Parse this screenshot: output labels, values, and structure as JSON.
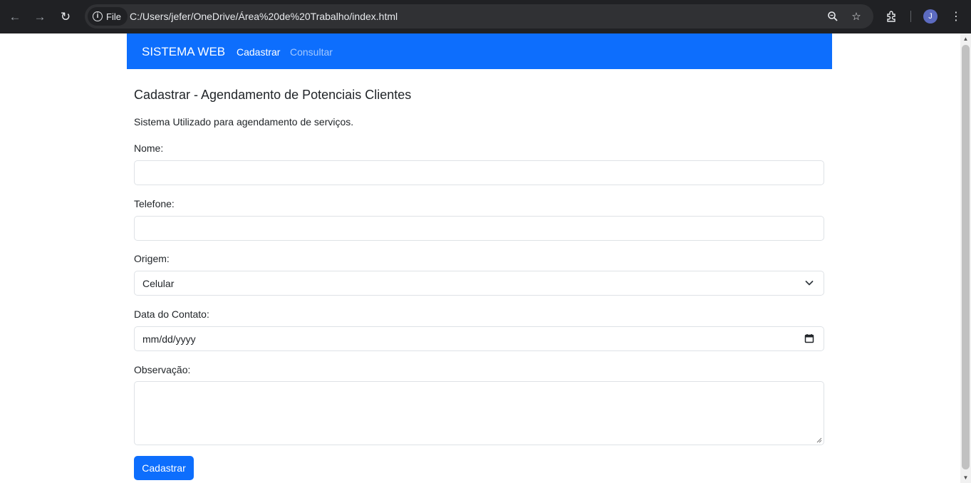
{
  "browser": {
    "site_chip_label": "File",
    "url": "C:/Users/jefer/OneDrive/Área%20de%20Trabalho/index.html",
    "profile_initial": "J"
  },
  "navbar": {
    "brand": "SISTEMA WEB",
    "links": [
      {
        "label": "Cadastrar",
        "active": true
      },
      {
        "label": "Consultar",
        "active": false
      }
    ],
    "color": "#0d6efd"
  },
  "page": {
    "title": "Cadastrar - Agendamento de Potenciais Clientes",
    "description": "Sistema Utilizado para agendamento de serviços."
  },
  "form": {
    "nome_label": "Nome:",
    "nome_value": "",
    "telefone_label": "Telefone:",
    "telefone_value": "",
    "origem_label": "Origem:",
    "origem_selected": "Celular",
    "data_label": "Data do Contato:",
    "data_placeholder": "mm/dd/yyyy",
    "observacao_label": "Observação:",
    "observacao_value": "",
    "submit_label": "Cadastrar"
  }
}
